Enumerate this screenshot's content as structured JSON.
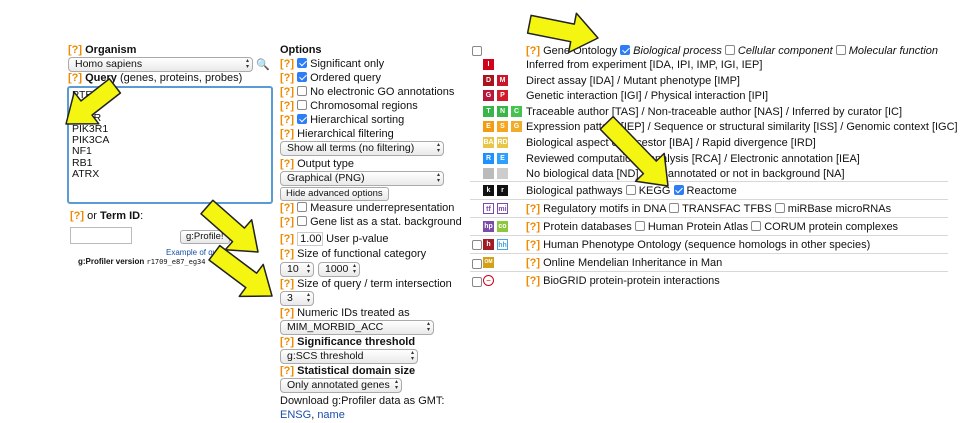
{
  "organism": {
    "q": "[?]",
    "label": "Organism",
    "selected": "Homo sapiens"
  },
  "query": {
    "q": "[?]",
    "label": "Query",
    "hint": "(genes, proteins, probes)",
    "lines": [
      "PTEN",
      "TP53",
      "EGFR",
      "PIK3R1",
      "PIK3CA",
      "NF1",
      "RB1",
      "ATRX"
    ]
  },
  "term_id": {
    "q": "[?]",
    "or": "or",
    "label": "Term ID",
    "colon": ":"
  },
  "gprofile_button": "g:Profile!",
  "example_text": "Example of query",
  "version": {
    "label": "g:Profiler version",
    "value": "r1709_e87_eg34"
  },
  "options": {
    "title": "Options",
    "significant_only": {
      "q": "[?]",
      "label": "Significant only",
      "checked": true
    },
    "ordered_query": {
      "q": "[?]",
      "label": "Ordered query",
      "checked": true
    },
    "no_electronic": {
      "q": "[?]",
      "label": "No electronic GO annotations",
      "checked": false
    },
    "chromosomal": {
      "q": "[?]",
      "label": "Chromosomal regions",
      "checked": false
    },
    "hierarchical_sorting": {
      "q": "[?]",
      "label": "Hierarchical sorting",
      "checked": true
    },
    "hier_filter": {
      "q": "[?]",
      "label": "Hierarchical filtering",
      "selected": "Show all terms (no filtering)"
    },
    "output_type": {
      "q": "[?]",
      "label": "Output type",
      "selected": "Graphical (PNG)"
    },
    "hide_adv": "Hide advanced options",
    "underrep": {
      "q": "[?]",
      "label": "Measure underrepresentation",
      "checked": false
    },
    "gene_list_bg": {
      "q": "[?]",
      "label": "Gene list as a stat. background",
      "checked": false
    },
    "pvalue": {
      "q": "[?]",
      "value": "1.00",
      "label": "User p-value"
    },
    "func_cat": {
      "q": "[?]",
      "label": "Size of functional category",
      "min": "10",
      "max": "1000"
    },
    "intersection": {
      "q": "[?]",
      "label": "Size of query / term intersection",
      "value": "3"
    },
    "numeric_ids": {
      "q": "[?]",
      "label": "Numeric IDs treated as",
      "selected": "MIM_MORBID_ACC"
    },
    "significance": {
      "q": "[?]",
      "label": "Significance threshold",
      "selected": "g:SCS threshold"
    },
    "domain_size": {
      "q": "[?]",
      "label": "Statistical domain size",
      "selected": "Only annotated genes"
    },
    "download": "Download g:Profiler data as GMT:",
    "links": {
      "ensg": "ENSG",
      "sep": ",",
      "name": "name"
    }
  },
  "sources": {
    "go": {
      "q": "[?]",
      "label": "Gene Ontology",
      "bp": "Biological process",
      "cc": "Cellular component",
      "mf": "Molecular function",
      "bp_checked": true
    },
    "evidence": [
      {
        "badge": [
          "I"
        ],
        "colors": [
          "#d0021b"
        ],
        "text": "Inferred from experiment [IDA, IPI, IMP, IGI, IEP]"
      },
      {
        "badge": [
          "D",
          "M"
        ],
        "colors": [
          "#a8141b",
          "#c9162b"
        ],
        "text": "Direct assay [IDA] / Mutant phenotype [IMP]"
      },
      {
        "badge": [
          "G",
          "P"
        ],
        "colors": [
          "#b6163b",
          "#d11a2a"
        ],
        "text": "Genetic interaction [IGI] / Physical interaction [IPI]"
      },
      {
        "badge": [
          "T",
          "N",
          "C"
        ],
        "colors": [
          "#39b54a",
          "#39b54a",
          "#45c24f"
        ],
        "text": "Traceable author [TAS] / Non-traceable author [NAS] / Inferred by curator [IC]"
      },
      {
        "badge": [
          "E",
          "S",
          "G"
        ],
        "colors": [
          "#f39c12",
          "#f5a623",
          "#f0ad2c"
        ],
        "text": "Expression pattern [IEP] / Sequence or structural similarity [ISS] / Genomic context [IGC]"
      },
      {
        "badge": [
          "BA",
          "RD"
        ],
        "colors": [
          "#e8c547",
          "#e8c547"
        ],
        "text": "Biological aspect of ancestor [IBA] / Rapid divergence [IRD]"
      },
      {
        "badge": [
          "R",
          "E"
        ],
        "colors": [
          "#1e90ff",
          "#30a0ff"
        ],
        "text": "Reviewed computational analysis [RCA] / Electronic annotation [IEA]"
      },
      {
        "badge": [
          "",
          ""
        ],
        "colors": [
          "#bbbbbb",
          "#cccccc"
        ],
        "text": "No biological data [ND] / Not annotated or not in background [NA]"
      }
    ],
    "pathways": {
      "label": "Biological pathways",
      "kegg": "KEGG",
      "reactome": "Reactome",
      "reactome_checked": true
    },
    "regulatory": {
      "q": "[?]",
      "label": "Regulatory motifs in DNA",
      "transfac": "TRANSFAC TFBS",
      "mirbase": "miRBase microRNAs"
    },
    "protein": {
      "q": "[?]",
      "label": "Protein databases",
      "hpa": "Human Protein Atlas",
      "corum": "CORUM protein complexes"
    },
    "hpo": {
      "q": "[?]",
      "label": "Human Phenotype Ontology",
      "note": "(sequence homologs in other species)"
    },
    "omim": {
      "q": "[?]",
      "label": "Online Mendelian Inheritance in Man"
    },
    "biogrid": {
      "q": "[?]",
      "label": "BioGRID protein-protein interactions"
    }
  },
  "colors": {
    "arrow_fill": "#f5f512",
    "arrow_stroke": "#222222",
    "help": "#f08a00",
    "check": "#2f7df6"
  }
}
